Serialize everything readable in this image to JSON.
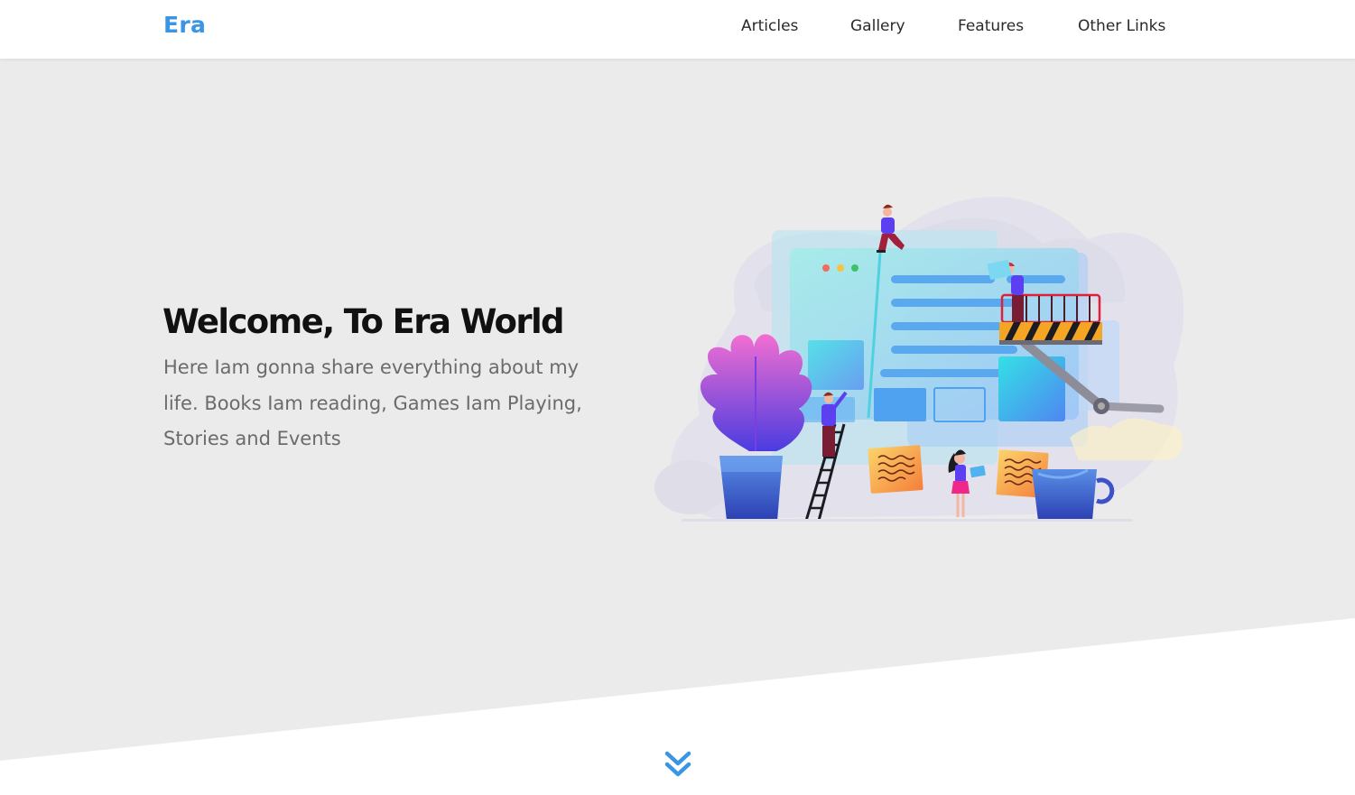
{
  "nav": {
    "brand": "Era",
    "links": [
      "Articles",
      "Gallery",
      "Features",
      "Other Links"
    ]
  },
  "hero": {
    "title": "Welcome, To Era World",
    "text": "Here Iam gonna share everything about my life. Books Iam reading, Games Iam Playing, Stories and Events"
  },
  "icons": {
    "illustration": "web-development-illustration",
    "scroll": "double-chevron-down-icon"
  },
  "colors": {
    "brand": "#3a96e4",
    "hero_bg": "#ebebeb",
    "title": "#111111",
    "text": "#6b6b6b",
    "scroll_icon": "#3a96e4"
  }
}
